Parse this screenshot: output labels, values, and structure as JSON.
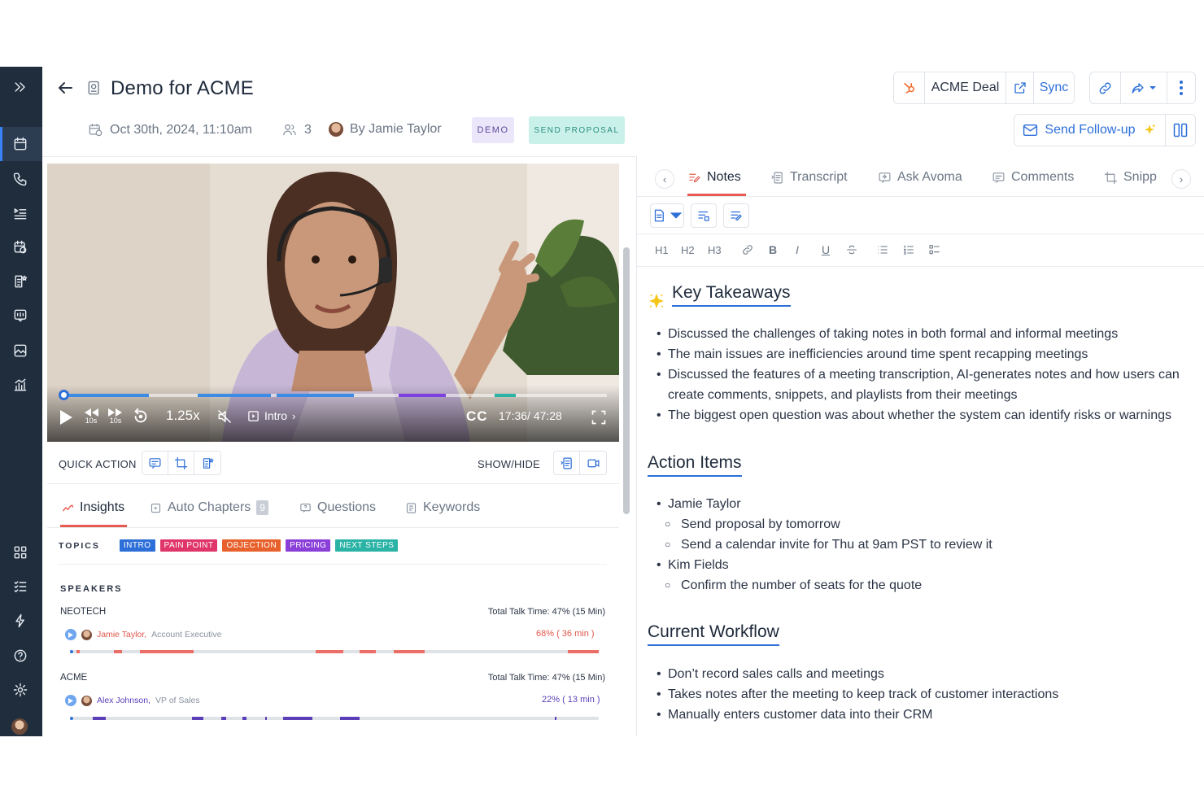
{
  "header": {
    "title": "Demo for ACME",
    "date": "Oct 30th, 2024, 11:10am",
    "attendees": "3",
    "by": "By Jamie Taylor",
    "badge_demo": "DEMO",
    "badge_send": "SEND PROPOSAL",
    "deal_label": "ACME Deal",
    "sync_label": "Sync",
    "follow_up_label": "Send Follow-up"
  },
  "video": {
    "speed": "1.25x",
    "chapter": "Intro",
    "cc": "CC",
    "time": "17:36/ 47:28",
    "skip_back": "10s",
    "skip_fwd": "10s"
  },
  "quick_action": {
    "label": "QUICK ACTION",
    "show_hide": "SHOW/HIDE"
  },
  "left_tabs": [
    {
      "label": "Insights"
    },
    {
      "label": "Auto Chapters",
      "count": "9"
    },
    {
      "label": "Questions"
    },
    {
      "label": "Keywords"
    }
  ],
  "topics": {
    "label": "TOPICS",
    "items": [
      {
        "label": "INTRO",
        "color": "#2d6fd8"
      },
      {
        "label": "PAIN POINT",
        "color": "#e0356b"
      },
      {
        "label": "OBJECTION",
        "color": "#e8612c"
      },
      {
        "label": "PRICING",
        "color": "#8b3fd9"
      },
      {
        "label": "NEXT STEPS",
        "color": "#2bb3a6"
      }
    ]
  },
  "speakers": {
    "label": "SPEAKERS",
    "groups": [
      {
        "org": "NEOTECH",
        "total": "Total Talk Time: 47% (15 Min)",
        "name": "Jamie Taylor,",
        "role": "Account Executive",
        "pct": "68%  ( 36 min )"
      },
      {
        "org": "ACME",
        "total": "Total Talk Time: 47% (15 Min)",
        "name": "Alex Johnson,",
        "role": "VP of Sales",
        "pct": "22%  ( 13 min )"
      }
    ]
  },
  "right_tabs": [
    {
      "label": "Notes"
    },
    {
      "label": "Transcript"
    },
    {
      "label": "Ask Avoma"
    },
    {
      "label": "Comments"
    },
    {
      "label": "Snipp"
    }
  ],
  "format": {
    "h1": "H1",
    "h2": "H2",
    "h3": "H3",
    "bold": "B",
    "italic": "I",
    "underline": "U"
  },
  "notes": {
    "key_takeaways": {
      "title": "Key Takeaways",
      "items": [
        "Discussed the challenges of taking notes in both formal and informal meetings",
        "The main issues are inefficiencies around time spent recapping meetings",
        "Discussed the features of a meeting transcription, AI-generates notes and how users can create comments, snippets, and playlists from their meetings",
        "The biggest open question was about whether the system can identify risks or warnings"
      ]
    },
    "action_items": {
      "title": "Action Items",
      "person1": "Jamie Taylor",
      "p1_items": [
        "Send proposal by tomorrow",
        "Send a calendar invite for Thu at 9am PST to review it"
      ],
      "person2": "Kim Fields",
      "p2_items": [
        "Confirm the number of seats for the quote"
      ]
    },
    "current_workflow": {
      "title": "Current Workflow",
      "items": [
        "Don’t record sales calls and meetings",
        "Takes notes after the meeting to keep track of customer interactions",
        "Manually enters customer data into their CRM"
      ]
    }
  }
}
